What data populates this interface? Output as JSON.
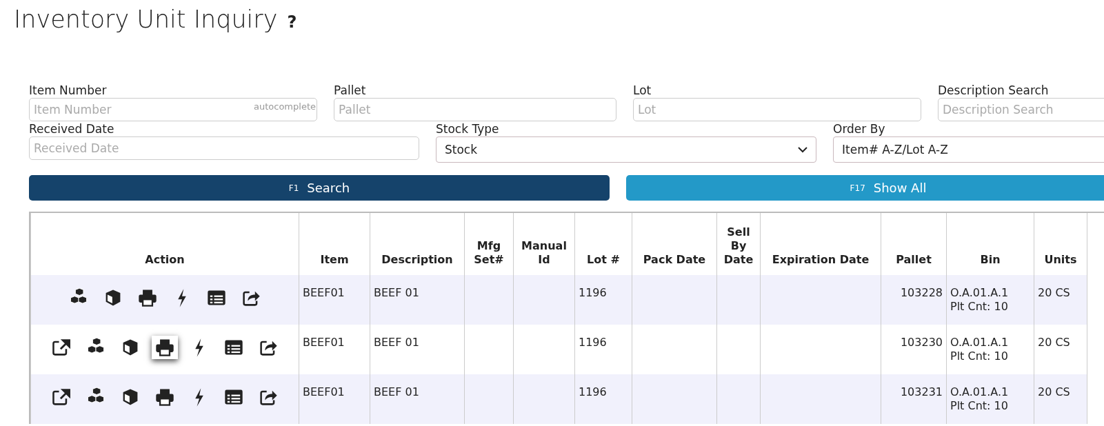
{
  "page": {
    "title": "Inventory Unit Inquiry",
    "help": "?"
  },
  "filters": {
    "row_1": [
      {
        "label": "Item Number",
        "placeholder": "Item Number",
        "hint": "autocomplete"
      },
      {
        "label": "Pallet",
        "placeholder": "Pallet"
      },
      {
        "label": "Lot",
        "placeholder": "Lot"
      },
      {
        "label": "Description Search",
        "placeholder": "Description Search"
      }
    ],
    "row_2": [
      {
        "kind": "text",
        "label": "Received Date",
        "placeholder": "Received Date"
      },
      {
        "kind": "select",
        "label": "Stock Type",
        "value": "Stock",
        "caret": true
      },
      {
        "kind": "select",
        "label": "Order By",
        "value": "Item# A-Z/Lot A-Z"
      }
    ]
  },
  "buttons": [
    {
      "key": "F1",
      "label": "Search",
      "kind": "primary"
    },
    {
      "key": "F17",
      "label": "Show All",
      "kind": "secondary"
    }
  ],
  "table": {
    "columns": [
      "Action",
      "Item",
      "Description",
      "Mfg Set#",
      "Manual Id",
      "Lot #",
      "Pack Date",
      "Sell By Date",
      "Expiration Date",
      "Pallet",
      "Bin",
      "Units"
    ],
    "rows": [
      {
        "actions": [
          {
            "kind": "boxes",
            "focused": false
          },
          {
            "kind": "box",
            "focused": false
          },
          {
            "kind": "print",
            "focused": false
          },
          {
            "kind": "bolt",
            "focused": false
          },
          {
            "kind": "list",
            "focused": false
          },
          {
            "kind": "share",
            "focused": false
          }
        ],
        "item": "BEEF01",
        "description": "BEEF 01",
        "lot": "1196",
        "pallet": "103228",
        "bin": "O.A.01.A.1",
        "pallet_count": "Plt Cnt: 10",
        "units": "20 CS"
      },
      {
        "actions": [
          {
            "kind": "external",
            "focused": false
          },
          {
            "kind": "boxes",
            "focused": false
          },
          {
            "kind": "box",
            "focused": false
          },
          {
            "kind": "print",
            "focused": true
          },
          {
            "kind": "bolt",
            "focused": false
          },
          {
            "kind": "list",
            "focused": false
          },
          {
            "kind": "share",
            "focused": false
          }
        ],
        "item": "BEEF01",
        "description": "BEEF 01",
        "lot": "1196",
        "pallet": "103230",
        "bin": "O.A.01.A.1",
        "pallet_count": "Plt Cnt: 10",
        "units": "20 CS"
      },
      {
        "actions": [
          {
            "kind": "external",
            "focused": false
          },
          {
            "kind": "boxes",
            "focused": false
          },
          {
            "kind": "box",
            "focused": false
          },
          {
            "kind": "print",
            "focused": false
          },
          {
            "kind": "bolt",
            "focused": false
          },
          {
            "kind": "list",
            "focused": false
          },
          {
            "kind": "share",
            "focused": false
          }
        ],
        "item": "BEEF01",
        "description": "BEEF 01",
        "lot": "1196",
        "pallet": "103231",
        "bin": "O.A.01.A.1",
        "pallet_count": "Plt Cnt: 10",
        "units": "20 CS"
      }
    ]
  }
}
